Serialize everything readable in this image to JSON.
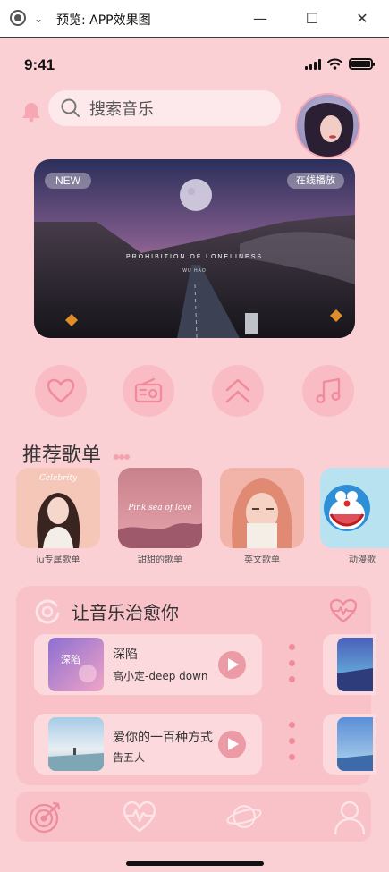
{
  "window": {
    "title": "预览: APP效果图"
  },
  "status": {
    "time": "9:41"
  },
  "search": {
    "placeholder": "搜索音乐"
  },
  "banner": {
    "badge_new": "NEW",
    "badge_play": "在线播放",
    "title": "PROHIBITION OF LONELINESS",
    "artist": "WU HAO"
  },
  "quick_actions": [
    "heart-icon",
    "radio-icon",
    "chevron-up-icon",
    "music-note-icon"
  ],
  "recommend": {
    "title": "推荐歌单",
    "playlists": [
      {
        "name": "iu专属歌单",
        "cover_text": "Celebrity"
      },
      {
        "name": "甜甜的歌单",
        "cover_text": "Pink sea of love"
      },
      {
        "name": "英文歌单",
        "cover_text": ""
      },
      {
        "name": "动漫歌",
        "cover_text": ""
      }
    ]
  },
  "healing": {
    "title": "让音乐治愈你",
    "songs": [
      {
        "title": "深陷",
        "artist": "高小定-deep down",
        "cover_text": "深陷"
      },
      {
        "title": "爱你的一百种方式",
        "artist": "告五人",
        "cover_text": ""
      }
    ]
  },
  "tabbar": [
    "target-icon",
    "heartbeat-icon",
    "planet-icon",
    "user-icon"
  ],
  "colors": {
    "background": "#fbd0d5",
    "card": "#f9c2c9",
    "accent": "#ec9aa5"
  }
}
